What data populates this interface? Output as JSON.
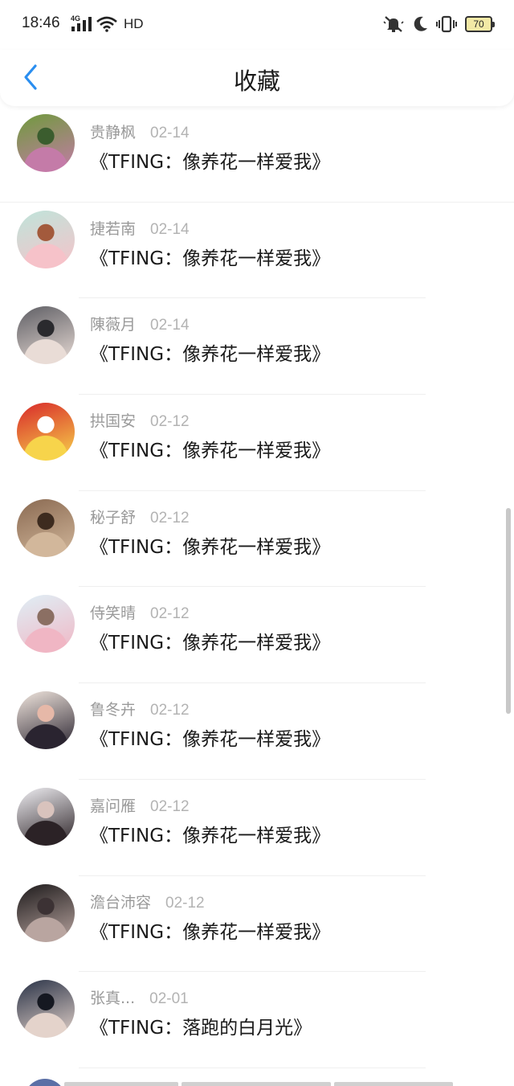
{
  "status_bar": {
    "time": "18:46",
    "network": "4G",
    "hd_label": "HD",
    "battery_level": "70",
    "icons": [
      "signal-icon",
      "wifi-icon",
      "mute-icon",
      "moon-icon",
      "vibrate-icon",
      "battery-icon"
    ]
  },
  "header": {
    "title": "收藏",
    "back_icon": "chevron-left-icon",
    "accent_color": "#2a8ef0"
  },
  "items": [
    {
      "name": "贵静枫",
      "date": "02-14",
      "title": "《TFING：像养花一样爱我》",
      "avatar_colors": [
        "#6f9a3c",
        "#c47ba8",
        "#3b5d2e"
      ]
    },
    {
      "name": "捷若南",
      "date": "02-14",
      "title": "《TFING：像养花一样爱我》",
      "avatar_colors": [
        "#bfe4da",
        "#f6c2c9",
        "#a35a3c"
      ]
    },
    {
      "name": "陳薇月",
      "date": "02-14",
      "title": "《TFING：像养花一样爱我》",
      "avatar_colors": [
        "#5e5e64",
        "#e9dcd6",
        "#2a2a2e"
      ]
    },
    {
      "name": "拱国安",
      "date": "02-12",
      "title": "《TFING：像养花一样爱我》",
      "avatar_colors": [
        "#d8292a",
        "#f7d44b",
        "#ffffff"
      ]
    },
    {
      "name": "秘子舒",
      "date": "02-12",
      "title": "《TFING：像养花一样爱我》",
      "avatar_colors": [
        "#8a6a52",
        "#d2b79b",
        "#3d2b1f"
      ]
    },
    {
      "name": "侍笑晴",
      "date": "02-12",
      "title": "《TFING：像养花一样爱我》",
      "avatar_colors": [
        "#dfeff6",
        "#f0b6c4",
        "#8b6f63"
      ]
    },
    {
      "name": "鲁冬卉",
      "date": "02-12",
      "title": "《TFING：像养花一样爱我》",
      "avatar_colors": [
        "#f1e6de",
        "#2a2430",
        "#e6b8a8"
      ]
    },
    {
      "name": "嘉问雁",
      "date": "02-12",
      "title": "《TFING：像养花一样爱我》",
      "avatar_colors": [
        "#efeef2",
        "#2b2226",
        "#d9c3bd"
      ]
    },
    {
      "name": "澹台沛容",
      "date": "02-12",
      "title": "《TFING：像养花一样爱我》",
      "avatar_colors": [
        "#1d1a1b",
        "#b9a5a0",
        "#3c3234"
      ]
    },
    {
      "name": "张真...",
      "date": "02-01",
      "title": "《TFING：落跑的白月光》",
      "avatar_colors": [
        "#2a3347",
        "#e4d3cb",
        "#151821"
      ]
    }
  ]
}
